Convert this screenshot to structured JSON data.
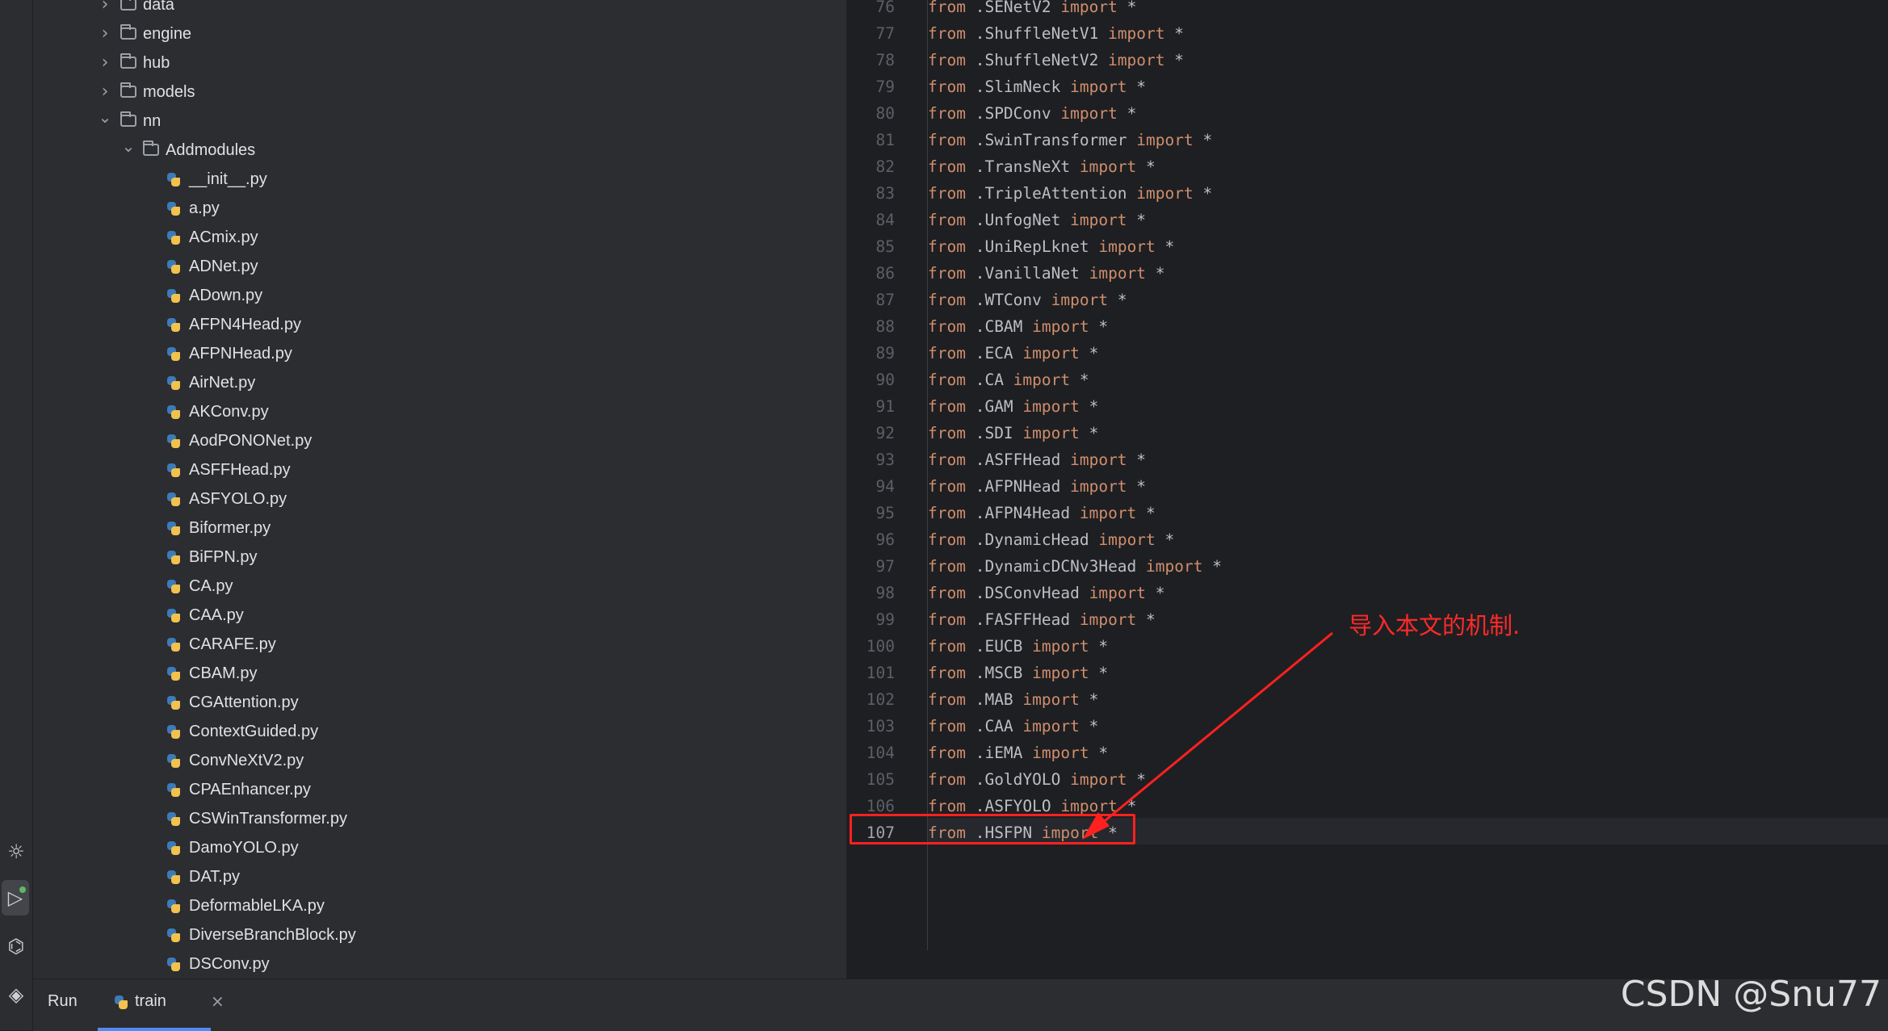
{
  "tree": {
    "rows": [
      {
        "label": "data",
        "type": "folder",
        "expanded": false,
        "depth": 1
      },
      {
        "label": "engine",
        "type": "folder",
        "expanded": false,
        "depth": 1
      },
      {
        "label": "hub",
        "type": "folder",
        "expanded": false,
        "depth": 1
      },
      {
        "label": "models",
        "type": "folder",
        "expanded": false,
        "depth": 1
      },
      {
        "label": "nn",
        "type": "folder",
        "expanded": true,
        "depth": 1
      },
      {
        "label": "Addmodules",
        "type": "folder",
        "expanded": true,
        "depth": 2
      },
      {
        "label": "__init__.py",
        "type": "py",
        "depth": 3
      },
      {
        "label": "a.py",
        "type": "py",
        "depth": 3
      },
      {
        "label": "ACmix.py",
        "type": "py",
        "depth": 3
      },
      {
        "label": "ADNet.py",
        "type": "py",
        "depth": 3
      },
      {
        "label": "ADown.py",
        "type": "py",
        "depth": 3
      },
      {
        "label": "AFPN4Head.py",
        "type": "py",
        "depth": 3
      },
      {
        "label": "AFPNHead.py",
        "type": "py",
        "depth": 3
      },
      {
        "label": "AirNet.py",
        "type": "py",
        "depth": 3
      },
      {
        "label": "AKConv.py",
        "type": "py",
        "depth": 3
      },
      {
        "label": "AodPONONet.py",
        "type": "py",
        "depth": 3
      },
      {
        "label": "ASFFHead.py",
        "type": "py",
        "depth": 3
      },
      {
        "label": "ASFYOLO.py",
        "type": "py",
        "depth": 3
      },
      {
        "label": "Biformer.py",
        "type": "py",
        "depth": 3
      },
      {
        "label": "BiFPN.py",
        "type": "py",
        "depth": 3
      },
      {
        "label": "CA.py",
        "type": "py",
        "depth": 3
      },
      {
        "label": "CAA.py",
        "type": "py",
        "depth": 3
      },
      {
        "label": "CARAFE.py",
        "type": "py",
        "depth": 3
      },
      {
        "label": "CBAM.py",
        "type": "py",
        "depth": 3
      },
      {
        "label": "CGAttention.py",
        "type": "py",
        "depth": 3
      },
      {
        "label": "ContextGuided.py",
        "type": "py",
        "depth": 3
      },
      {
        "label": "ConvNeXtV2.py",
        "type": "py",
        "depth": 3
      },
      {
        "label": "CPAEnhancer.py",
        "type": "py",
        "depth": 3
      },
      {
        "label": "CSWinTransformer.py",
        "type": "py",
        "depth": 3
      },
      {
        "label": "DamoYOLO.py",
        "type": "py",
        "depth": 3
      },
      {
        "label": "DAT.py",
        "type": "py",
        "depth": 3
      },
      {
        "label": "DeformableLKA.py",
        "type": "py",
        "depth": 3
      },
      {
        "label": "DiverseBranchBlock.py",
        "type": "py",
        "depth": 3
      },
      {
        "label": "DSConv.py",
        "type": "py",
        "depth": 3
      }
    ]
  },
  "editor": {
    "current_line": "107",
    "lines": [
      {
        "n": "76",
        "mod": ".SENetV2"
      },
      {
        "n": "77",
        "mod": ".ShuffleNetV1"
      },
      {
        "n": "78",
        "mod": ".ShuffleNetV2"
      },
      {
        "n": "79",
        "mod": ".SlimNeck"
      },
      {
        "n": "80",
        "mod": ".SPDConv"
      },
      {
        "n": "81",
        "mod": ".SwinTransformer"
      },
      {
        "n": "82",
        "mod": ".TransNeXt"
      },
      {
        "n": "83",
        "mod": ".TripleAttention"
      },
      {
        "n": "84",
        "mod": ".UnfogNet"
      },
      {
        "n": "85",
        "mod": ".UniRepLknet"
      },
      {
        "n": "86",
        "mod": ".VanillaNet"
      },
      {
        "n": "87",
        "mod": ".WTConv"
      },
      {
        "n": "88",
        "mod": ".CBAM"
      },
      {
        "n": "89",
        "mod": ".ECA"
      },
      {
        "n": "90",
        "mod": ".CA"
      },
      {
        "n": "91",
        "mod": ".GAM"
      },
      {
        "n": "92",
        "mod": ".SDI"
      },
      {
        "n": "93",
        "mod": ".ASFFHead"
      },
      {
        "n": "94",
        "mod": ".AFPNHead"
      },
      {
        "n": "95",
        "mod": ".AFPN4Head"
      },
      {
        "n": "96",
        "mod": ".DynamicHead"
      },
      {
        "n": "97",
        "mod": ".DynamicDCNv3Head"
      },
      {
        "n": "98",
        "mod": ".DSConvHead"
      },
      {
        "n": "99",
        "mod": ".FASFFHead"
      },
      {
        "n": "100",
        "mod": ".EUCB"
      },
      {
        "n": "101",
        "mod": ".MSCB"
      },
      {
        "n": "102",
        "mod": ".MAB"
      },
      {
        "n": "103",
        "mod": ".CAA"
      },
      {
        "n": "104",
        "mod": ".iEMA"
      },
      {
        "n": "105",
        "mod": ".GoldYOLO"
      },
      {
        "n": "106",
        "mod": ".ASFYOLO"
      },
      {
        "n": "107",
        "mod": ".HSFPN"
      }
    ],
    "kw_from": "from",
    "kw_import": "import",
    "star": "*"
  },
  "annotation": {
    "text": "导入本文的机制.",
    "color": "#ff2020"
  },
  "bottom_bar": {
    "run_label": "Run",
    "tab_label": "train",
    "close_glyph": "×"
  },
  "watermark": "CSDN @Snu77",
  "colors": {
    "keyword": "#cf8e6d",
    "text": "#bcbec4",
    "panel": "#2b2d30",
    "editor": "#1e1f22",
    "accent": "#548af7"
  }
}
